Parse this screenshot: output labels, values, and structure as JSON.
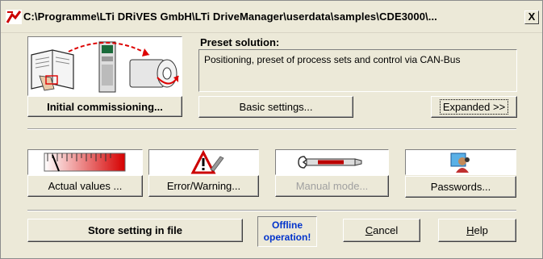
{
  "window": {
    "title": "C:\\Programme\\LTi DRiVES GmbH\\LTi DriveManager\\userdata\\samples\\CDE3000\\...",
    "close_label": "X",
    "bg_color": "#ece9d8"
  },
  "preset": {
    "label": "Preset solution:",
    "text": "Positioning, preset of process sets and control via CAN-Bus"
  },
  "buttons": {
    "initial_commissioning": "Initial commissioning...",
    "basic_settings": "Basic settings...",
    "expanded": "Expanded >>",
    "actual_values": "Actual values ...",
    "error_warning": "Error/Warning...",
    "manual_mode": "Manual mode...",
    "passwords": "Passwords...",
    "store_setting": "Store setting in file",
    "cancel_prefix": "",
    "cancel_ul": "C",
    "cancel_rest": "ancel",
    "help_ul": "H",
    "help_rest": "elp"
  },
  "status": {
    "line1": "Offline",
    "line2": "operation!",
    "color": "#0033cc"
  },
  "icons": {
    "commissioning": "book-drive-motor-illustration",
    "actual_values": "gauge-meter-icon",
    "error_warning": "warning-triangle-icon",
    "manual_mode": "wrench-icon",
    "passwords": "user-key-icon"
  }
}
